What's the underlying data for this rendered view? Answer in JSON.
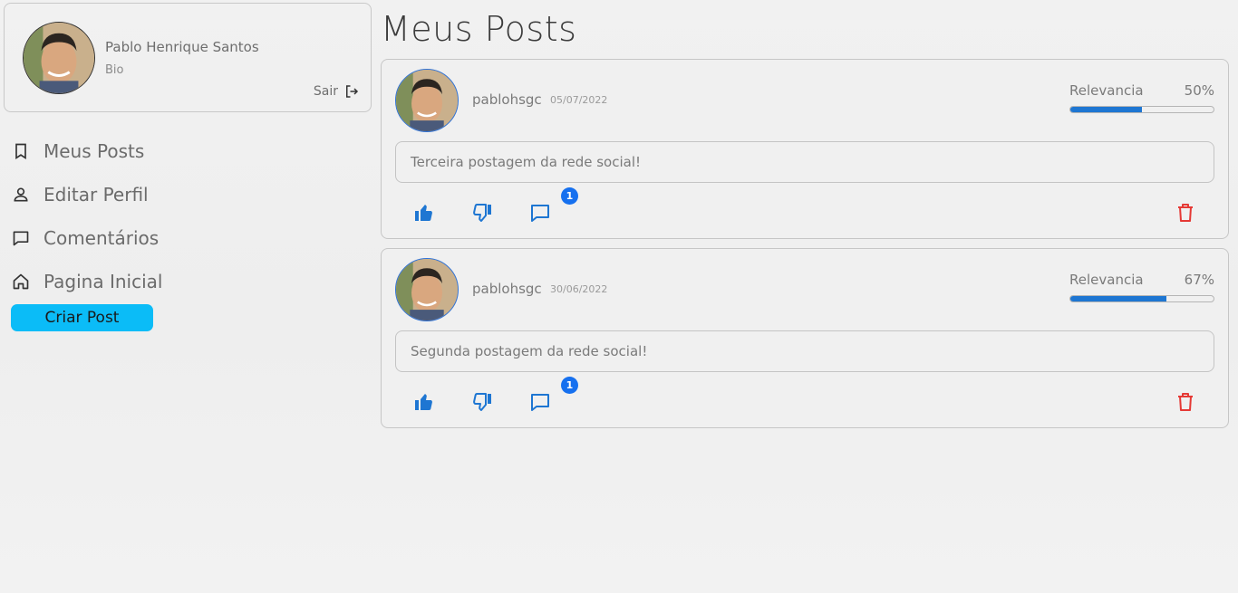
{
  "profile": {
    "name": "Pablo Henrique Santos",
    "bio": "Bio",
    "logout_label": "Sair"
  },
  "nav": {
    "items": [
      {
        "label": "Meus Posts",
        "icon": "bookmark-icon"
      },
      {
        "label": "Editar Perfil",
        "icon": "person-icon"
      },
      {
        "label": "Comentários",
        "icon": "comment-icon"
      },
      {
        "label": "Pagina Inicial",
        "icon": "home-icon"
      }
    ],
    "create_post_label": "Criar Post"
  },
  "main": {
    "title": "Meus Posts",
    "posts": [
      {
        "username": "pablohsgc",
        "date": "05/07/2022",
        "relevance_label": "Relevancia",
        "relevance_value": "50%",
        "relevance_fraction": 0.5,
        "content": "Terceira postagem da rede social!",
        "comment_count": "1"
      },
      {
        "username": "pablohsgc",
        "date": "30/06/2022",
        "relevance_label": "Relevancia",
        "relevance_value": "67%",
        "relevance_fraction": 0.67,
        "content": "Segunda postagem da rede social!",
        "comment_count": "1"
      }
    ]
  },
  "colors": {
    "accent": "#0bbcf7",
    "progress": "#1e76d2",
    "action_blue": "#1e76d2",
    "delete_red": "#e53935",
    "badge": "#1670ef"
  }
}
